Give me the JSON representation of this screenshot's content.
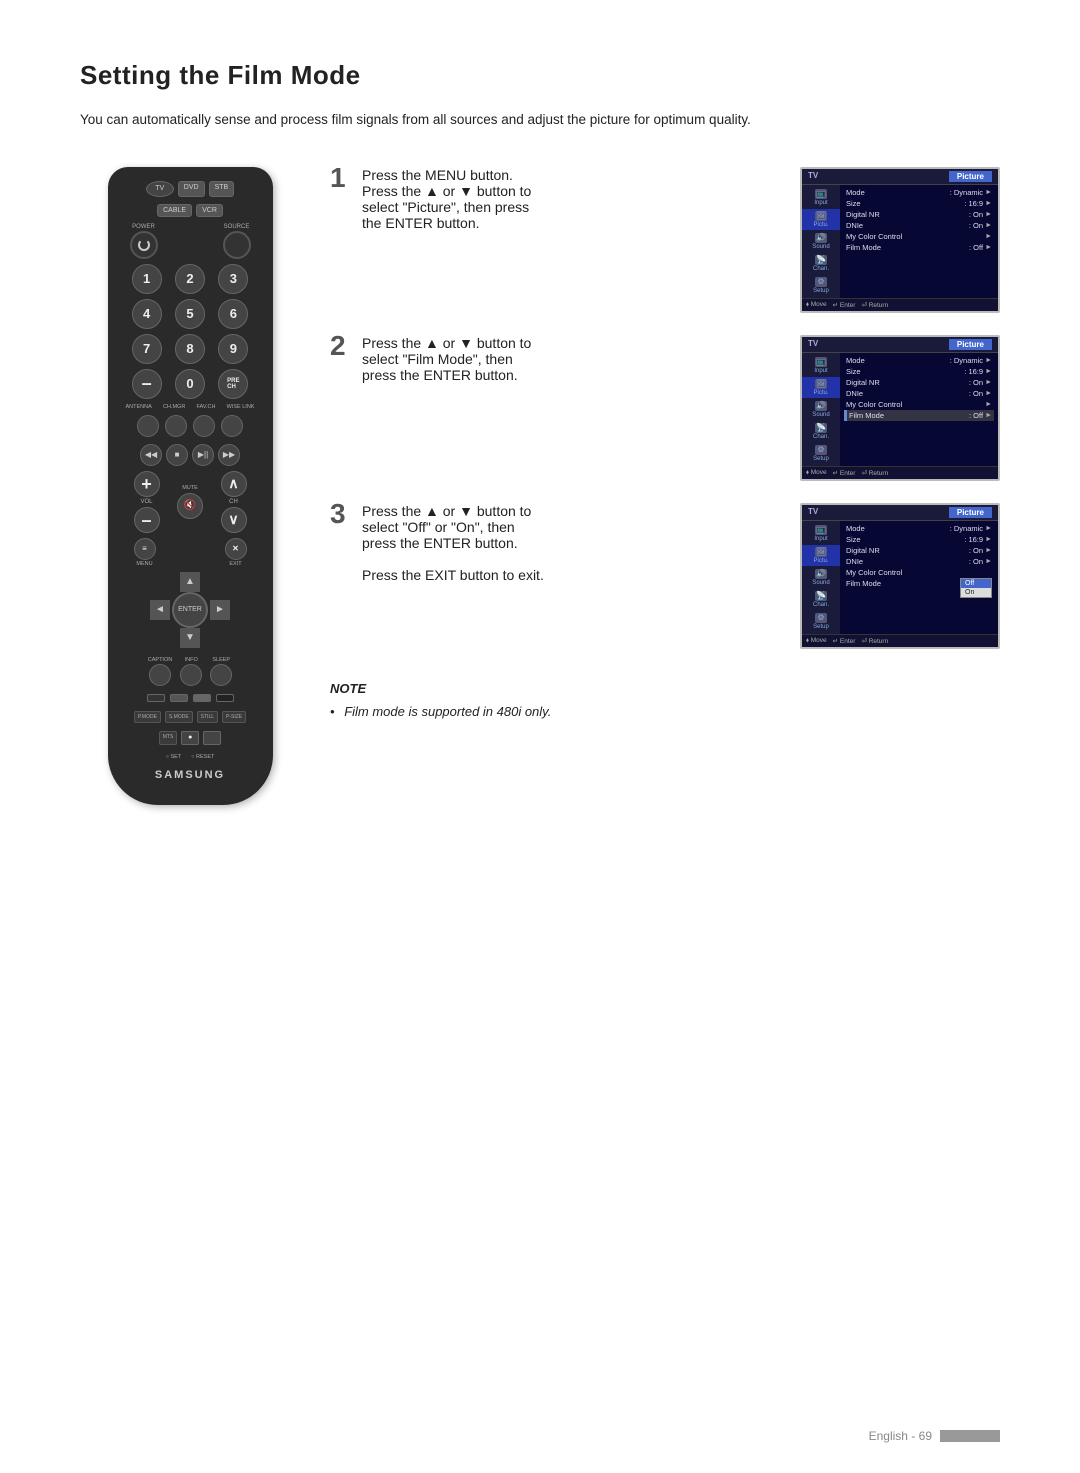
{
  "page": {
    "title": "Setting the Film Mode",
    "intro": "You can automatically sense and process film signals from all sources and adjust the picture for optimum quality."
  },
  "steps": [
    {
      "number": "1",
      "instruction_line1": "Press the MENU button.",
      "instruction_line2": "Press the ▲ or ▼ button to",
      "instruction_line3": "select \"Picture\", then press",
      "instruction_line4": "the ENTER button.",
      "screen": {
        "header_left": "TV",
        "header_right": "Picture",
        "menu_items": [
          {
            "label": "Mode",
            "value": ": Dynamic",
            "arrow": true
          },
          {
            "label": "Size",
            "value": ": 16:9",
            "arrow": true
          },
          {
            "label": "Digital NR",
            "value": ": On",
            "arrow": true
          },
          {
            "label": "DNIe",
            "value": ": On",
            "arrow": true
          },
          {
            "label": "My Color Control",
            "value": "",
            "arrow": true
          },
          {
            "label": "Film Mode",
            "value": ": Off",
            "arrow": true
          }
        ],
        "sidebar_items": [
          "Input",
          "Picture",
          "Sound",
          "Channel",
          "Setup"
        ]
      }
    },
    {
      "number": "2",
      "instruction_line1": "Press the ▲ or ▼ button to",
      "instruction_line2": "select \"Film Mode\", then",
      "instruction_line3": "press the ENTER button.",
      "screen": {
        "header_left": "TV",
        "header_right": "Picture",
        "menu_items": [
          {
            "label": "Mode",
            "value": ": Dynamic",
            "arrow": true
          },
          {
            "label": "Size",
            "value": ": 16:9",
            "arrow": true
          },
          {
            "label": "Digital NR",
            "value": ": On",
            "arrow": true
          },
          {
            "label": "DNIe",
            "value": ": On",
            "arrow": true
          },
          {
            "label": "My Color Control",
            "value": "",
            "arrow": true
          },
          {
            "label": "Film Mode",
            "value": ": Off",
            "arrow": true,
            "highlighted": true
          }
        ],
        "sidebar_items": [
          "Input",
          "Picture",
          "Sound",
          "Channel",
          "Setup"
        ]
      }
    },
    {
      "number": "3",
      "instruction_line1": "Press the ▲ or ▼ button to",
      "instruction_line2": "select \"Off\" or \"On\", then",
      "instruction_line3": "press the ENTER button.",
      "instruction_line4": "",
      "instruction_line5": "Press the EXIT button to exit.",
      "screen": {
        "header_left": "TV",
        "header_right": "Picture",
        "menu_items": [
          {
            "label": "Mode",
            "value": ": Dynamic",
            "arrow": true
          },
          {
            "label": "Size",
            "value": ": 16:9",
            "arrow": true
          },
          {
            "label": "Digital NR",
            "value": ": On",
            "arrow": true
          },
          {
            "label": "DNIe",
            "value": ": On",
            "arrow": true
          },
          {
            "label": "My Color Control",
            "value": "",
            "arrow": false
          },
          {
            "label": "Film Mode",
            "value": "",
            "arrow": false,
            "has_popup": true
          }
        ],
        "popup_items": [
          "Off",
          "On"
        ],
        "sidebar_items": [
          "Input",
          "Picture",
          "Sound",
          "Channel",
          "Setup"
        ]
      }
    }
  ],
  "note": {
    "title": "NOTE",
    "items": [
      "Film mode is supported in 480i only."
    ]
  },
  "footer": {
    "text": "English - 69"
  },
  "remote": {
    "brand": "SAMSUNG",
    "buttons": {
      "tv": "TV",
      "dvd": "DVD",
      "stb": "STB",
      "cable": "CABLE",
      "vcr": "VCR",
      "power": "POWER",
      "source": "SOURCE",
      "numbers": [
        "1",
        "2",
        "3",
        "4",
        "5",
        "6",
        "7",
        "8",
        "9",
        "-",
        "0"
      ],
      "pre_ch": "PRE-CH",
      "antenna": "ANTENNA",
      "ch_mgr": "CH.MGR",
      "fav_ch": "FAV.CH",
      "wise_link": "WISE LINK",
      "vol": "VOL",
      "ch": "CH",
      "mute": "MUTE",
      "menu": "MENU",
      "exit": "EXIT",
      "enter": "ENTER",
      "caption": "CAPTION",
      "info": "INFO",
      "sleep": "SLEEP",
      "p_mode": "P.MODE",
      "s_mode": "S.MODE",
      "still": "STILL",
      "p_size": "P-SIZE",
      "mts": "MTS",
      "set": "SET",
      "reset": "RESET"
    }
  }
}
